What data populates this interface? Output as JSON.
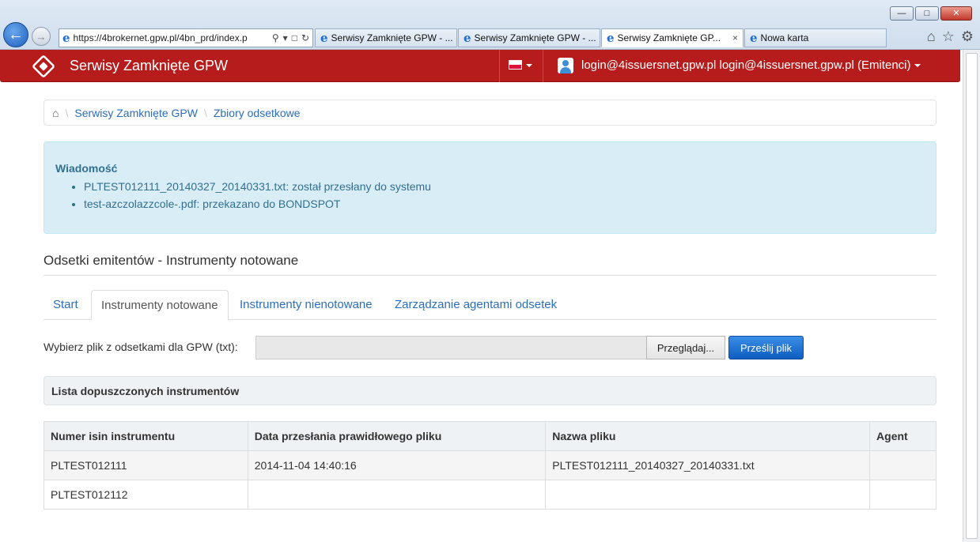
{
  "browser": {
    "back_icon": "back-arrow-icon",
    "forward_icon": "forward-arrow-icon",
    "address_url": "https://4brokernet.gpw.pl/4bn_prd/index.p",
    "tabs": [
      {
        "label": "Serwisy Zamknięte GPW - ..."
      },
      {
        "label": "Serwisy Zamknięte GPW - ..."
      },
      {
        "label": "Serwisy Zamknięte GP...",
        "close": "×"
      },
      {
        "label": "Nowa karta"
      }
    ],
    "window_controls": {
      "minimize": "—",
      "maximize": "□",
      "close": "✕"
    },
    "toolbar_icons": [
      "home-icon",
      "star-icon",
      "gear-icon"
    ]
  },
  "navbar": {
    "brand": "Serwisy Zamknięte GPW",
    "user": "login@4issuersnet.gpw.pl login@4issuersnet.gpw.pl (Emitenci)",
    "language_flag": "flag-pl-icon",
    "accent_color": "#b71c1c"
  },
  "breadcrumb": {
    "items": [
      "Serwisy Zamknięte GPW",
      "Zbiory odsetkowe"
    ]
  },
  "alert": {
    "title": "Wiadomość",
    "messages": [
      "PLTEST012111_20140327_20140331.txt: został przesłany do systemu",
      "test-azczolazzcole-.pdf: przekazano do BONDSPOT"
    ]
  },
  "section": {
    "title": "Odsetki emitentów - Instrumenty notowane"
  },
  "tabs": [
    {
      "label": "Start",
      "active": false
    },
    {
      "label": "Instrumenty notowane",
      "active": true
    },
    {
      "label": "Instrumenty nienotowane",
      "active": false
    },
    {
      "label": "Zarządzanie agentami odsetek",
      "active": false
    }
  ],
  "upload": {
    "label": "Wybierz plik z odsetkami dla GPW (txt):",
    "file_value": "",
    "browse_label": "Przeglądaj...",
    "submit_label": "Prześlij plik"
  },
  "panel": {
    "title": "Lista dopuszczonych instrumentów"
  },
  "table": {
    "headers": [
      "Numer isin instrumentu",
      "Data przesłania prawidłowego pliku",
      "Nazwa pliku",
      "Agent"
    ],
    "rows": [
      [
        "PLTEST012111",
        "2014-11-04 14:40:16",
        "PLTEST012111_20140327_20140331.txt",
        ""
      ],
      [
        "PLTEST012112",
        "",
        "",
        ""
      ]
    ]
  }
}
